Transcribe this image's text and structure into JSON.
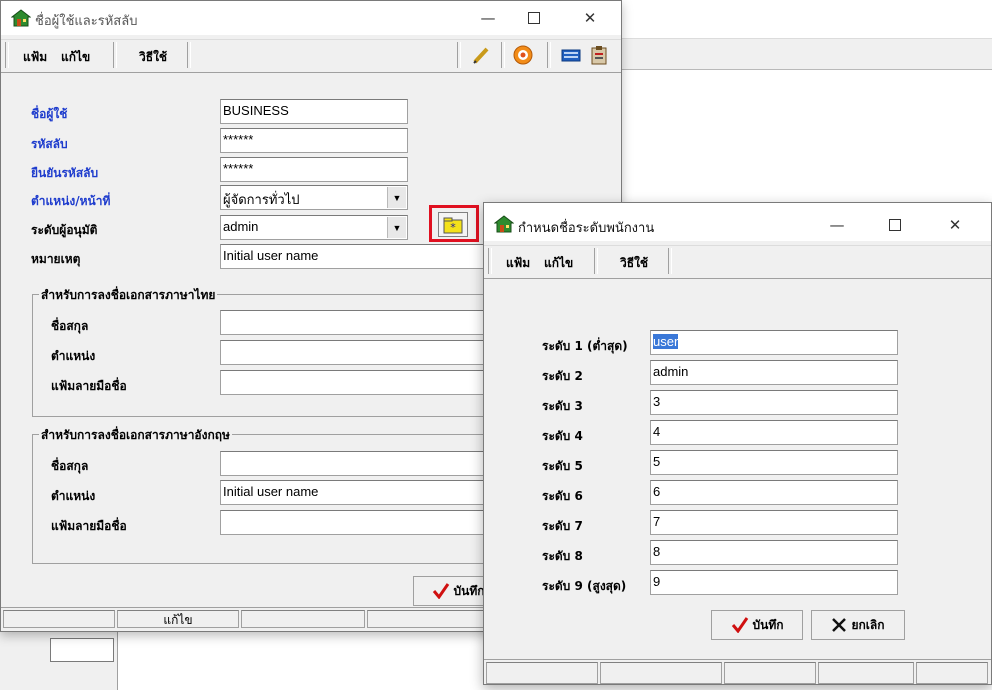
{
  "window_user": {
    "title": "ชื่อผู้ใช้และรหัสลับ",
    "menu": [
      "แฟ้ม",
      "แก้ไข",
      "วิธีใช้"
    ],
    "fields": {
      "username_label": "ชื่อผู้ใช้",
      "username_value": "BUSINESS",
      "password_label": "รหัสลับ",
      "password_value": "******",
      "confirm_label": "ยืนยันรหัสลับ",
      "confirm_value": "******",
      "position_label": "ตำแหน่ง/หน้าที่",
      "position_value": "ผู้จัดการทั่วไป",
      "approval_label": "ระดับผู้อนุมัติ",
      "approval_value": "admin",
      "note_label": "หมายเหตุ",
      "note_value": "Initial user name"
    },
    "thai_group": {
      "title": "สำหรับการลงชื่อเอกสารภาษาไทย",
      "name_label": "ชื่อสกุล",
      "name_value": "",
      "position_label": "ตำแหน่ง",
      "position_value": "",
      "signature_label": "แฟ้มลายมือชื่อ",
      "signature_value": ""
    },
    "english_group": {
      "title": "สำหรับการลงชื่อเอกสารภาษาอังกฤษ",
      "name_label": "ชื่อสกุล",
      "name_value": "",
      "position_label": "ตำแหน่ง",
      "position_value": "Initial user name",
      "signature_label": "แฟ้มลายมือชื่อ",
      "signature_value": ""
    },
    "save_button": "บันทึก",
    "status": [
      "",
      "แก้ไข",
      "",
      "",
      ""
    ]
  },
  "window_levels": {
    "title": "กำหนดชื่อระดับพนักงาน",
    "menu": [
      "แฟ้ม",
      "แก้ไข",
      "วิธีใช้"
    ],
    "levels": [
      {
        "label": "ระดับ 1 (ต่ำสุด)",
        "value": "user"
      },
      {
        "label": "ระดับ 2",
        "value": "admin"
      },
      {
        "label": "ระดับ 3",
        "value": "3"
      },
      {
        "label": "ระดับ 4",
        "value": "4"
      },
      {
        "label": "ระดับ 5",
        "value": "5"
      },
      {
        "label": "ระดับ 6",
        "value": "6"
      },
      {
        "label": "ระดับ 7",
        "value": "7"
      },
      {
        "label": "ระดับ 8",
        "value": "8"
      },
      {
        "label": "ระดับ 9 (สูงสุด)",
        "value": "9"
      }
    ],
    "save_button": "บันทึก",
    "cancel_button": "ยกเลิก"
  },
  "icons": [
    "app-house-icon",
    "pen-icon",
    "target-icon",
    "keyboard-icon",
    "clipboard-icon",
    "checkmark-icon",
    "cross-icon",
    "folder-star-icon"
  ],
  "colors": {
    "label_blue": "#1e3ccd",
    "highlight_red": "#e01020",
    "check_red": "#d01010",
    "selection_blue": "#3a78d8"
  }
}
